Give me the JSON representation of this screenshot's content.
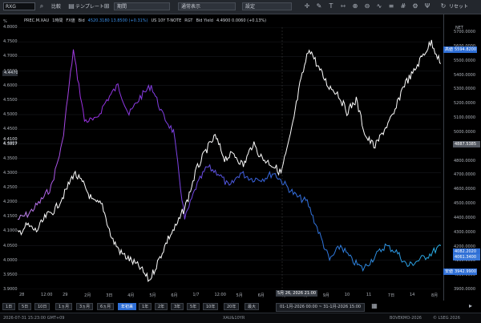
{
  "toolbar": {
    "symbol": "RXG",
    "compare_label": "比較",
    "template_label": "テンプレート",
    "period_select": "期間",
    "chart_type_select": "通常表示",
    "extra_select": "設定",
    "options_label": "リセット"
  },
  "legend": {
    "s1_name": "PREC.M.XAU",
    "s1_interval": "1時間",
    "s1_source": "FX値",
    "s1_label": "Bid",
    "s1_values": "4520.3180 13.8500 (+0.31%)",
    "s2_name": "US 10Y T-NOTE",
    "s2_source": "RGT",
    "s2_label": "Bid Yield",
    "s2_values": "4.4900 0.0060 (+0.13%)"
  },
  "left_axis": {
    "unit": "%",
    "ticks": [
      "4.8000",
      "4.7500",
      "4.7000",
      "4.6500",
      "4.6000",
      "4.5500",
      "4.5000",
      "4.4500",
      "4.4000",
      "4.3500",
      "4.3000",
      "4.2500",
      "4.2000",
      "4.1500",
      "4.1000",
      "4.0500",
      "4.0000",
      "3.9500",
      "3.9000"
    ],
    "current_value": "4.4470",
    "marker_1": "4.4100",
    "marker_2": "4.3817"
  },
  "right_axis": {
    "unit": "NET",
    "ticks": [
      "5700.0000",
      "5600.0000",
      "5500.0000",
      "5400.0000",
      "5300.0000",
      "5200.0000",
      "5100.0000",
      "5000.0000",
      "4900.0000",
      "4800.0000",
      "4700.0000",
      "4600.0000",
      "4500.0000",
      "4400.0000",
      "4300.0000",
      "4200.0000",
      "4100.0000",
      "4000.0000",
      "3900.0000"
    ],
    "high_label": "高値",
    "high_value": "5594.8200",
    "last_value": "4887.5385",
    "mid_value_1": "4082.2020",
    "mid_value_2": "4061.3400",
    "low_label": "安値",
    "low_value": "3942.9900"
  },
  "x_axis": {
    "ticks": [
      "28",
      "12:00",
      "29",
      "2月",
      "3日",
      "4月",
      "5月",
      "6月",
      "1/7",
      "12:00",
      "5月",
      "6月",
      "7月",
      "8月",
      "9月",
      "10",
      "11",
      "7日",
      "14",
      "8月"
    ],
    "cursor_date": "5月 26, 2026",
    "cursor_time": "21:00"
  },
  "periods": [
    "1日",
    "5日",
    "10日",
    "1ヵ月",
    "3ヵ月",
    "6ヵ月",
    "年初来",
    "1年",
    "2年",
    "3年",
    "5年",
    "10年",
    "20年",
    "最大"
  ],
  "active_period": "年初来",
  "date_range": "01-1月-2026 00:00 ~ 31-1月-2026 15:00",
  "footer": {
    "timestamp": "2026-07-31 15:23:00 GMT+09",
    "center": "XAU&10YR",
    "right1": "BOVEKMO-2026",
    "right2": "© LSEG 2026"
  },
  "colors": {
    "gold_line": "#ffffff",
    "yield_line_start": "#9b2fe0",
    "yield_line_end": "#2aa8e0",
    "high_box": "#2f6fd6",
    "low_box": "#2f6fd6",
    "active_period": "#2f6fd6"
  },
  "chart_data": {
    "type": "line",
    "series": [
      {
        "name": "PREC.M.XAU",
        "axis": "right",
        "values": [
          4280,
          4340,
          4300,
          4400,
          4450,
          4560,
          4700,
          4620,
          4500,
          4480,
          4250,
          4150,
          4100,
          4050,
          3960,
          4100,
          4250,
          4350,
          4500,
          4720,
          4850,
          4950,
          4800,
          4830,
          4750,
          4900,
          4800,
          4760,
          4700,
          4950,
          5300,
          5560,
          5420,
          5300,
          5250,
          5120,
          5200,
          4950,
          4880,
          5000,
          5100,
          5300,
          5380,
          5500,
          5600,
          5450
        ]
      },
      {
        "name": "US 10Y T-NOTE",
        "axis": "left",
        "values": [
          4.14,
          4.16,
          4.2,
          4.25,
          4.4,
          4.72,
          4.48,
          4.48,
          4.55,
          4.6,
          4.5,
          4.56,
          4.6,
          4.5,
          4.44,
          4.14,
          4.25,
          4.32,
          4.3,
          4.25,
          4.3,
          4.28,
          4.28,
          4.3,
          4.26,
          4.22,
          4.2,
          4.1,
          4.0,
          4.05,
          4.0,
          3.97,
          4.01,
          4.05,
          4.03,
          3.98,
          4.0,
          4.02,
          4.05
        ]
      }
    ],
    "left_ylim": [
      3.9,
      4.8
    ],
    "right_ylim": [
      3900,
      5700
    ]
  }
}
